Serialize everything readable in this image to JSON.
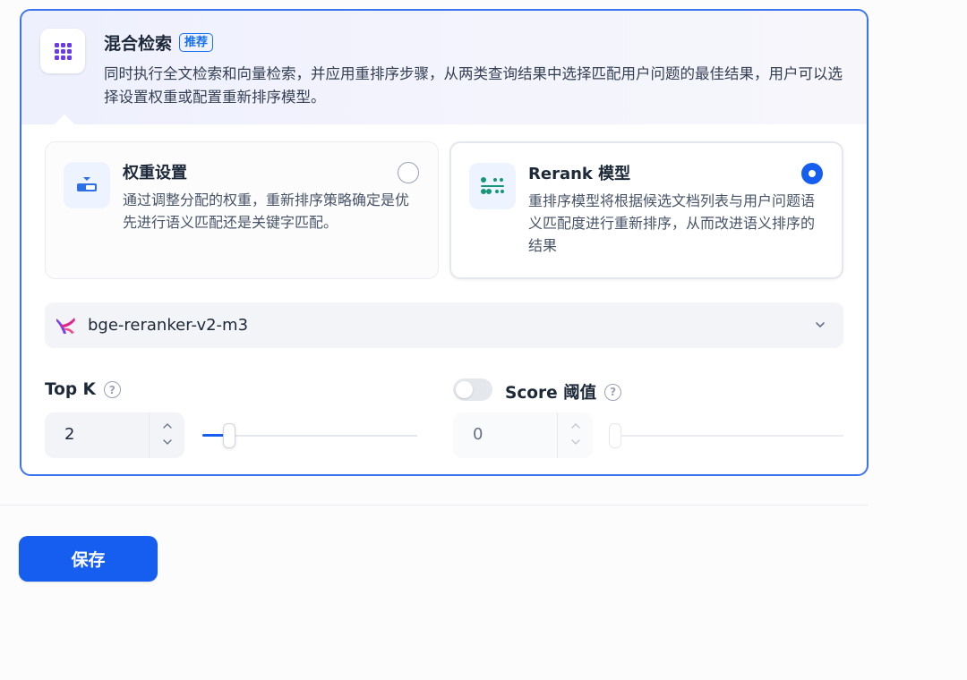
{
  "hybrid_search": {
    "title": "混合检索",
    "badge": "推荐",
    "description": "同时执行全文检索和向量检索，并应用重排序步骤，从两类查询结果中选择匹配用户问题的最佳结果，用户可以选择设置权重或配置重新排序模型。",
    "icon": "grid-dots-icon"
  },
  "options": [
    {
      "title": "权重设置",
      "description": "通过调整分配的权重，重新排序策略确定是优先进行语义匹配还是关键字匹配。",
      "selected": false,
      "icon": "weight-balance-icon"
    },
    {
      "title": "Rerank 模型",
      "description": "重排序模型将根据候选文档列表与用户问题语义匹配度进行重新排序，从而改进语义排序的结果",
      "selected": true,
      "icon": "rerank-sliders-icon"
    }
  ],
  "model_select": {
    "value": "bge-reranker-v2-m3",
    "icon": "model-provider-logo"
  },
  "top_k": {
    "label": "Top K",
    "value": "2",
    "slider_fraction": 0.12
  },
  "score_threshold": {
    "label": "Score 阈值",
    "enabled": false,
    "value": "0",
    "slider_fraction": 0.0
  },
  "save_label": "保存",
  "colors": {
    "accent": "#155eef",
    "border_active": "#3b73f0",
    "icon_purple": "#6938ef"
  }
}
